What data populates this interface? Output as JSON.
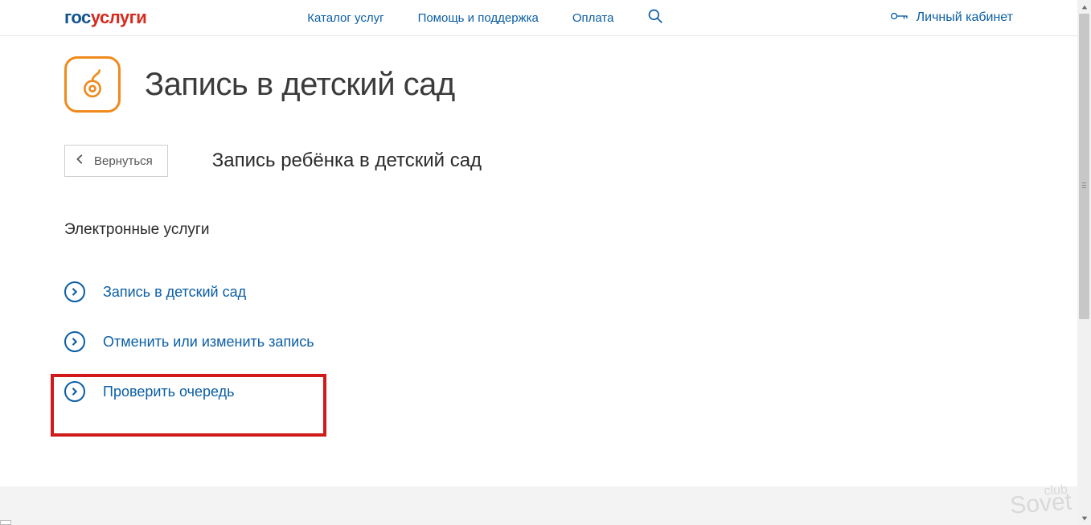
{
  "brand": {
    "part1": "гос",
    "part2": "услуги"
  },
  "nav": {
    "catalog": "Каталог услуг",
    "help": "Помощь и поддержка",
    "pay": "Оплата"
  },
  "cabinet": "Личный кабинет",
  "page_title": "Запись в детский сад",
  "back_label": "Вернуться",
  "subtitle": "Запись ребёнка в детский сад",
  "section": "Электронные услуги",
  "services": {
    "s1": "Запись в детский сад",
    "s2": "Отменить или изменить запись",
    "s3": "Проверить очередь"
  },
  "watermark": {
    "top": "club",
    "main": "Sovet"
  }
}
